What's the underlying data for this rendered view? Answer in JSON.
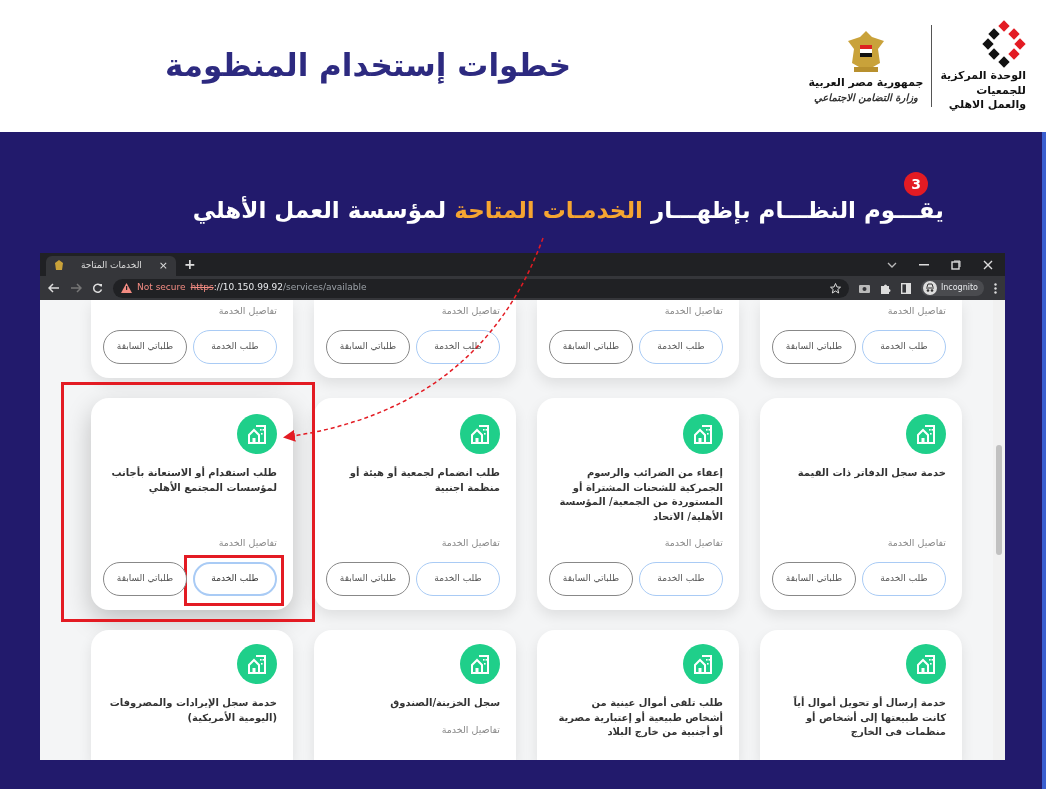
{
  "header": {
    "title": "خطوات إستخدام المنظومة",
    "ministry_lines": [
      "جمهورية مصر العربية",
      "وزارة التضامن الاجتماعي"
    ],
    "unit_lines": [
      "الوحدة المركزية",
      "للجمعيات",
      "والعمل الاهلي"
    ]
  },
  "step": {
    "number": "3",
    "text_before": "يقـــوم النظـــام بإظهـــار",
    "text_highlight": "الخدمـات المتاحة",
    "text_after": "لمؤسسة العمل الأهلي"
  },
  "browser": {
    "tab": {
      "title": "الخدمات المتاحة",
      "close": "×",
      "selected": true
    },
    "new_tab": "+",
    "security": "Not secure",
    "url": {
      "scheme": "https",
      "host": "://10.150.99.92",
      "path": "/services/available"
    },
    "profile": "Incognito"
  },
  "service_rows": [
    {
      "kind": "cut_top",
      "cards": [
        {
          "highlighted": false,
          "details": "تفاصيل الخدمة",
          "buttons": [
            {
              "kind": "request",
              "label": "طلب الخدمة",
              "highlighted": false
            },
            {
              "kind": "history",
              "label": "طلباتي السابقة",
              "highlighted": false
            }
          ]
        },
        {
          "highlighted": false,
          "details": "تفاصيل الخدمة",
          "buttons": [
            {
              "kind": "request",
              "label": "طلب الخدمة",
              "highlighted": false
            },
            {
              "kind": "history",
              "label": "طلباتي السابقة",
              "highlighted": false
            }
          ]
        },
        {
          "highlighted": false,
          "details": "تفاصيل الخدمة",
          "buttons": [
            {
              "kind": "request",
              "label": "طلب الخدمة",
              "highlighted": false
            },
            {
              "kind": "history",
              "label": "طلباتي السابقة",
              "highlighted": false
            }
          ]
        },
        {
          "highlighted": false,
          "details": "تفاصيل الخدمة",
          "buttons": [
            {
              "kind": "request",
              "label": "طلب الخدمة",
              "highlighted": false
            },
            {
              "kind": "history",
              "label": "طلباتي السابقة",
              "highlighted": false
            }
          ]
        }
      ]
    },
    {
      "kind": "full",
      "cards": [
        {
          "highlighted": false,
          "title": "خدمة سجل الدفاتر ذات القيمة",
          "details": "تفاصيل الخدمة",
          "buttons": [
            {
              "kind": "request",
              "label": "طلب الخدمة",
              "highlighted": false
            },
            {
              "kind": "history",
              "label": "طلباتي السابقة",
              "highlighted": false
            }
          ]
        },
        {
          "highlighted": false,
          "title": "إعفاء من الضرائب والرسوم الجمركية للشحنات المشتراة أو المستوردة من الجمعية/ المؤسسة الأهلية/ الاتحاد",
          "details": "تفاصيل الخدمة",
          "buttons": [
            {
              "kind": "request",
              "label": "طلب الخدمة",
              "highlighted": false
            },
            {
              "kind": "history",
              "label": "طلباتي السابقة",
              "highlighted": false
            }
          ]
        },
        {
          "highlighted": false,
          "title": "طلب انضمام لجمعية أو هيئة أو منظمة اجنبية",
          "details": "تفاصيل الخدمة",
          "buttons": [
            {
              "kind": "request",
              "label": "طلب الخدمة",
              "highlighted": false
            },
            {
              "kind": "history",
              "label": "طلباتي السابقة",
              "highlighted": false
            }
          ]
        },
        {
          "highlighted": true,
          "title": "طلب استقدام أو الاستعانة بأجانب لمؤسسات المجتمع الأهلي",
          "details": "تفاصيل الخدمة",
          "buttons": [
            {
              "kind": "request",
              "label": "طلب الخدمة",
              "highlighted": true
            },
            {
              "kind": "history",
              "label": "طلباتي السابقة",
              "highlighted": false
            }
          ]
        }
      ]
    },
    {
      "kind": "cut_bottom",
      "cards": [
        {
          "highlighted": false,
          "title": "خدمة إرسال أو تحويل أموال أياً كانت طبيعتها إلى أشخاص أو منظمات فى الخارج"
        },
        {
          "highlighted": false,
          "title": "طلب تلقى أموال عينية من أشخاص طبيعية أو إعتبارية مصرية أو أجنبية من خارج البلاد"
        },
        {
          "highlighted": false,
          "title": "سجل الخزينة/الصندوق",
          "details": "تفاصيل الخدمة"
        },
        {
          "highlighted": false,
          "title": "خدمة سجل الإيرادات والمصروفات (اليومية الأمريكية)"
        }
      ]
    }
  ]
}
